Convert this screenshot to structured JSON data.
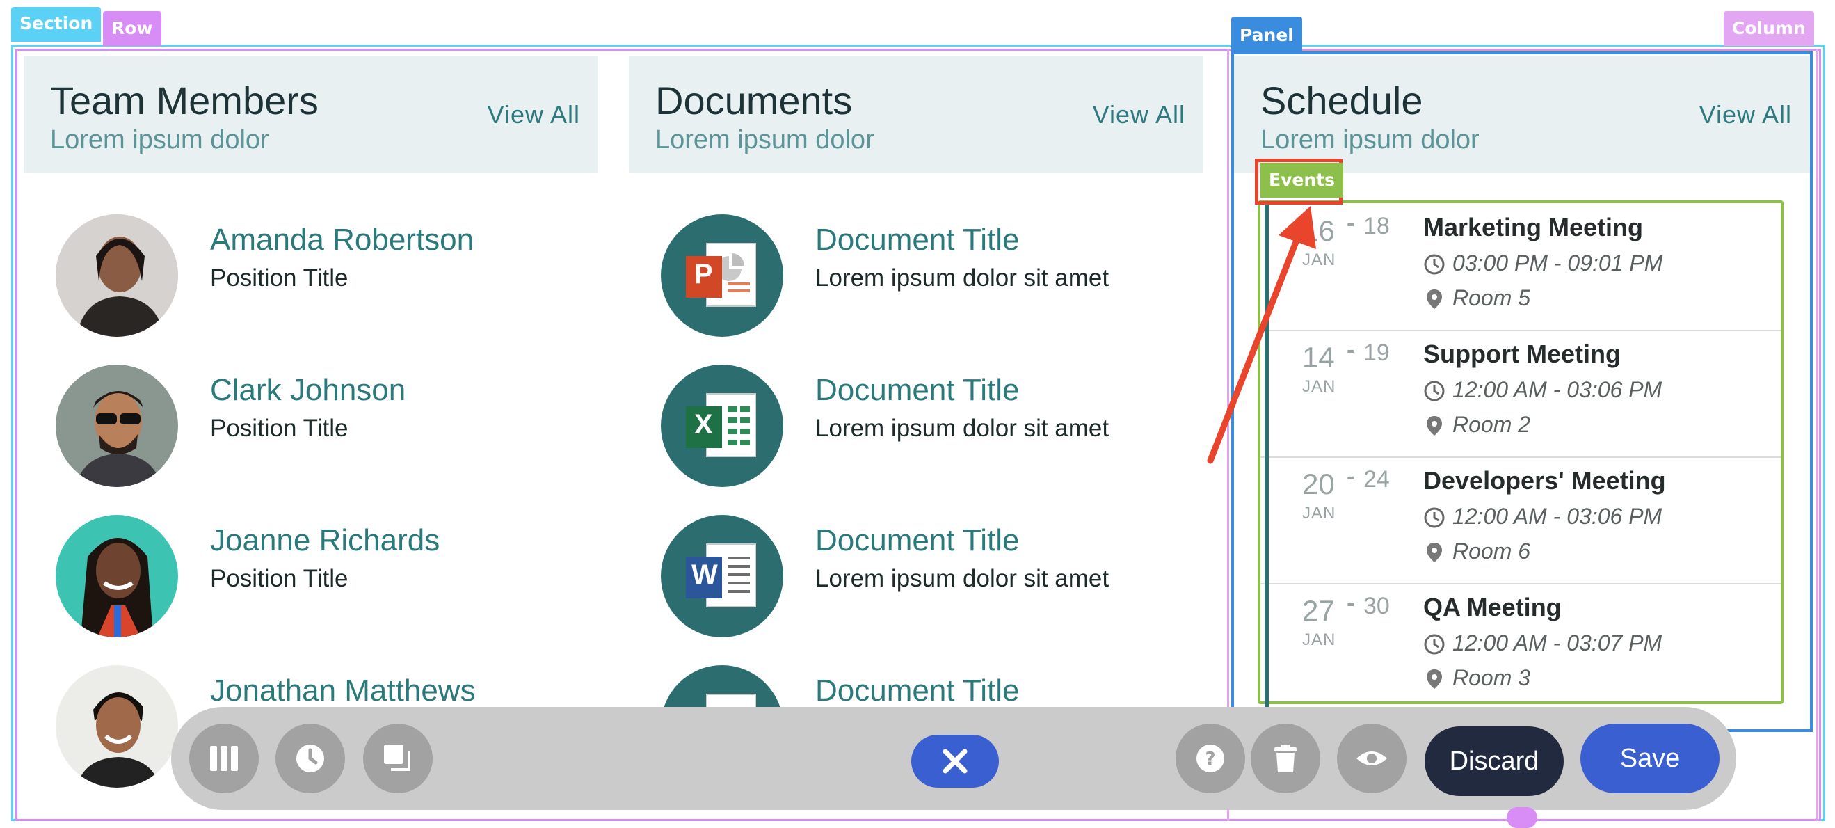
{
  "editor_tags": {
    "section": "Section",
    "row": "Row",
    "panel": "Panel",
    "column": "Column",
    "events": "Events"
  },
  "colors": {
    "section": "#5bd2f5",
    "row": "#d88cf5",
    "panel": "#3a8dde",
    "column": "#e3a6f3",
    "events": "#8dc04a",
    "arrow": "#e8452c",
    "accent_teal": "#2a7a7c",
    "save_blue": "#3a5fd0"
  },
  "team": {
    "title": "Team Members",
    "subtitle": "Lorem ipsum dolor",
    "view_all": "View All",
    "members": [
      {
        "name": "Amanda Robertson",
        "position": "Position Title"
      },
      {
        "name": "Clark Johnson",
        "position": "Position Title"
      },
      {
        "name": "Joanne Richards",
        "position": "Position Title"
      },
      {
        "name": "Jonathan Matthews",
        "position": ""
      }
    ]
  },
  "documents": {
    "title": "Documents",
    "subtitle": "Lorem ipsum dolor",
    "view_all": "View All",
    "items": [
      {
        "title": "Document Title",
        "desc": "Lorem ipsum dolor sit amet",
        "icon": "powerpoint-icon",
        "letter": "P"
      },
      {
        "title": "Document Title",
        "desc": "Lorem ipsum dolor sit amet",
        "icon": "excel-icon",
        "letter": "X"
      },
      {
        "title": "Document Title",
        "desc": "Lorem ipsum dolor sit amet",
        "icon": "word-icon",
        "letter": "W"
      },
      {
        "title": "Document Title",
        "desc": "",
        "icon": "pdf-icon",
        "letter": ""
      }
    ]
  },
  "schedule": {
    "title": "Schedule",
    "subtitle": "Lorem ipsum dolor",
    "view_all": "View All",
    "events": [
      {
        "start": "16",
        "end": "18",
        "month": "JAN",
        "title": "Marketing Meeting",
        "time": "03:00 PM - 09:01 PM",
        "room": "Room 5"
      },
      {
        "start": "14",
        "end": "19",
        "month": "JAN",
        "title": "Support Meeting",
        "time": "12:00 AM - 03:06 PM",
        "room": "Room 2"
      },
      {
        "start": "20",
        "end": "24",
        "month": "JAN",
        "title": "Developers' Meeting",
        "time": "12:00 AM - 03:06 PM",
        "room": "Room 6"
      },
      {
        "start": "27",
        "end": "30",
        "month": "JAN",
        "title": "QA Meeting",
        "time": "12:00 AM - 03:07 PM",
        "room": "Room 3"
      }
    ]
  },
  "toolbar": {
    "left_buttons": [
      "columns-icon",
      "history-icon",
      "duplicate-icon"
    ],
    "close": "close-icon",
    "right_buttons": [
      "help-icon",
      "trash-icon",
      "preview-icon"
    ],
    "discard_label": "Discard",
    "save_label": "Save"
  }
}
